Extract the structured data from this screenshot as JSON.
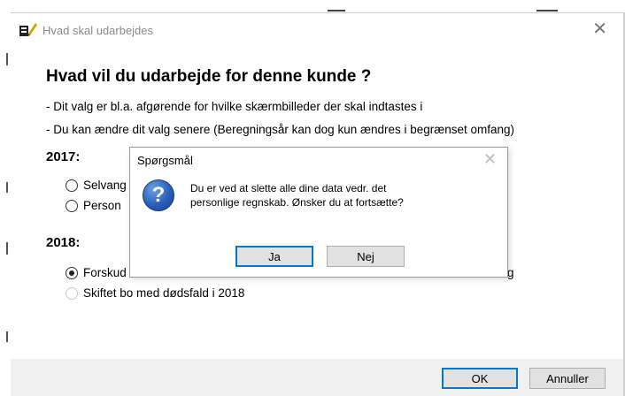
{
  "window": {
    "title": "Hvad skal udarbejdes",
    "close_glyph": "✕"
  },
  "main": {
    "heading": "Hvad vil du udarbejde for denne kunde ?",
    "info_lines": [
      "- Dit valg er bl.a. afgørende for hvilke skærmbilleder der skal indtastes i",
      "- Du kan ændre dit valg senere (Beregningsår kan dog kun ændres i begrænset omfang)"
    ],
    "year_2017": {
      "label": "2017:",
      "options": [
        "Selvang",
        "Person"
      ]
    },
    "year_2018": {
      "label": "2018:",
      "options": [
        "Forskud",
        "Skiftet bo med dødsfald i 2018"
      ],
      "option_tail": "g"
    }
  },
  "footer": {
    "ok_label": "OK",
    "cancel_label": "Annuller"
  },
  "dialog": {
    "title": "Spørgsmål",
    "close_glyph": "✕",
    "icon": "question-icon",
    "message_line1": "Du er ved at slette alle dine data vedr. det",
    "message_line2": "personlige regnskab. Ønsker du at fortsætte?",
    "yes_label": "Ja",
    "no_label": "Nej"
  },
  "colors": {
    "accent": "#0078d7",
    "footer_bg": "#f0f0f0",
    "button_bg": "#e1e1e1"
  }
}
